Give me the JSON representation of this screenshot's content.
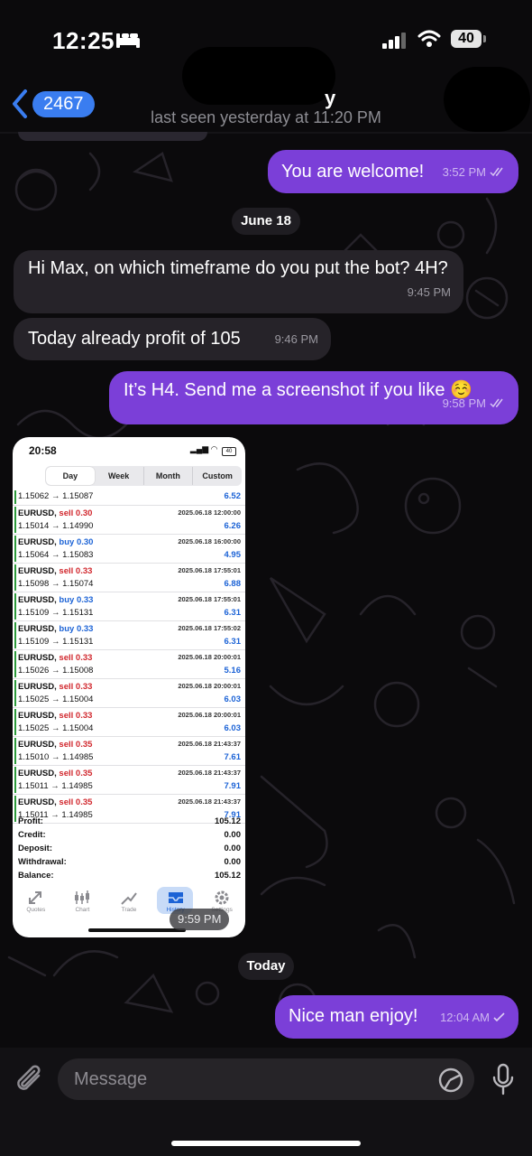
{
  "status_bar": {
    "time": "12:25",
    "battery": "40"
  },
  "header": {
    "back_count": "2467",
    "name_suffix": "y",
    "last_seen": "last seen yesterday at 11:20 PM"
  },
  "messages": [
    {
      "type": "out",
      "text": "You are welcome!",
      "time": "3:52 PM"
    },
    {
      "type": "date",
      "text": "June 18"
    },
    {
      "type": "in",
      "text": "Hi Max, on which timeframe do you put the bot? 4H?",
      "time": "9:45 PM"
    },
    {
      "type": "in",
      "text": "Today already profit of 105",
      "time": "9:46 PM"
    },
    {
      "type": "out",
      "text": "It’s H4. Send me a screenshot if you like ☺️",
      "time": "9:58 PM"
    },
    {
      "type": "photo",
      "time": "9:59 PM"
    },
    {
      "type": "date",
      "text": "Today"
    },
    {
      "type": "out",
      "text": "Nice man enjoy!",
      "time": "12:04 AM"
    }
  ],
  "screenshot": {
    "time": "20:58",
    "battery": "40",
    "tabs": [
      "Day",
      "Week",
      "Month",
      "Custom"
    ],
    "first_row": {
      "prices": "1.15062 → 1.15087",
      "profit": "6.52"
    },
    "deals": [
      {
        "symbol": "EURUSD,",
        "side": "sell",
        "lots": "0.30",
        "date": "2025.06.18 12:00:00",
        "prices": "1.15014 → 1.14990",
        "profit": "6.26"
      },
      {
        "symbol": "EURUSD,",
        "side": "buy",
        "lots": "0.30",
        "date": "2025.06.18 16:00:00",
        "prices": "1.15064 → 1.15083",
        "profit": "4.95"
      },
      {
        "symbol": "EURUSD,",
        "side": "sell",
        "lots": "0.33",
        "date": "2025.06.18 17:55:01",
        "prices": "1.15098 → 1.15074",
        "profit": "6.88"
      },
      {
        "symbol": "EURUSD,",
        "side": "buy",
        "lots": "0.33",
        "date": "2025.06.18 17:55:01",
        "prices": "1.15109 → 1.15131",
        "profit": "6.31"
      },
      {
        "symbol": "EURUSD,",
        "side": "buy",
        "lots": "0.33",
        "date": "2025.06.18 17:55:02",
        "prices": "1.15109 → 1.15131",
        "profit": "6.31"
      },
      {
        "symbol": "EURUSD,",
        "side": "sell",
        "lots": "0.33",
        "date": "2025.06.18 20:00:01",
        "prices": "1.15026 → 1.15008",
        "profit": "5.16"
      },
      {
        "symbol": "EURUSD,",
        "side": "sell",
        "lots": "0.33",
        "date": "2025.06.18 20:00:01",
        "prices": "1.15025 → 1.15004",
        "profit": "6.03"
      },
      {
        "symbol": "EURUSD,",
        "side": "sell",
        "lots": "0.33",
        "date": "2025.06.18 20:00:01",
        "prices": "1.15025 → 1.15004",
        "profit": "6.03"
      },
      {
        "symbol": "EURUSD,",
        "side": "sell",
        "lots": "0.35",
        "date": "2025.06.18 21:43:37",
        "prices": "1.15010 → 1.14985",
        "profit": "7.61"
      },
      {
        "symbol": "EURUSD,",
        "side": "sell",
        "lots": "0.35",
        "date": "2025.06.18 21:43:37",
        "prices": "1.15011 → 1.14985",
        "profit": "7.91"
      },
      {
        "symbol": "EURUSD,",
        "side": "sell",
        "lots": "0.35",
        "date": "2025.06.18 21:43:37",
        "prices": "1.15011 → 1.14985",
        "profit": "7.91"
      }
    ],
    "summary": [
      {
        "label": "Profit:",
        "value": "105.12"
      },
      {
        "label": "Credit:",
        "value": "0.00"
      },
      {
        "label": "Deposit:",
        "value": "0.00"
      },
      {
        "label": "Withdrawal:",
        "value": "0.00"
      },
      {
        "label": "Balance:",
        "value": "105.12"
      }
    ],
    "bottom_tabs": [
      "Quotes",
      "Chart",
      "Trade",
      "History",
      "Settings"
    ],
    "active_bottom_tab": "History"
  },
  "input": {
    "placeholder": "Message"
  },
  "colors": {
    "outgoing": "#7b3fd8",
    "incoming": "#262329",
    "badge": "#3a7df0",
    "sell": "#d1272d",
    "buy": "#1c63d6"
  }
}
